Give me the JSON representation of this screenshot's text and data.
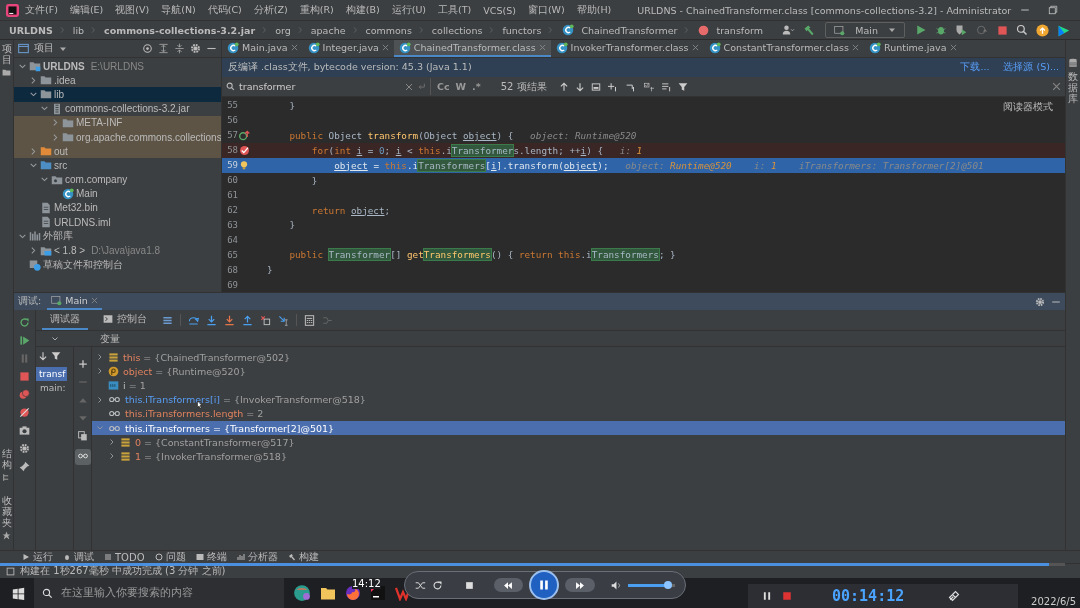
{
  "window": {
    "title": "URLDNS - ChainedTransformer.class [commons-collections-3.2] - Administrator"
  },
  "menu": [
    "文件(F)",
    "编辑(E)",
    "视图(V)",
    "导航(N)",
    "代码(C)",
    "分析(Z)",
    "重构(R)",
    "构建(B)",
    "运行(U)",
    "工具(T)",
    "VCS(S)",
    "窗口(W)",
    "帮助(H)"
  ],
  "breadcrumbs": [
    {
      "label": "URLDNS",
      "bold": true
    },
    {
      "label": "lib",
      "bold": false
    },
    {
      "label": "commons-collections-3.2.jar",
      "bold": true
    },
    {
      "label": "org",
      "bold": false
    },
    {
      "label": "apache",
      "bold": false
    },
    {
      "label": "commons",
      "bold": false
    },
    {
      "label": "collections",
      "bold": false
    },
    {
      "label": "functors",
      "bold": false
    },
    {
      "label": "ChainedTransformer",
      "bold": false
    },
    {
      "label": "transform",
      "bold": false
    }
  ],
  "run_config": "Main",
  "side_labels": {
    "left_top": "项目",
    "left_bottom": [
      "结构",
      "收藏夹"
    ],
    "right": "数据库"
  },
  "project": {
    "title": "项目",
    "tree": [
      {
        "label": "URLDNS",
        "detail": "E:\\URLDNS",
        "kind": "module",
        "expanded": true,
        "selected": false,
        "excluded": false,
        "children": [
          {
            "label": ".idea",
            "kind": "folder",
            "expanded": false,
            "selected": false,
            "excluded": false
          },
          {
            "label": "lib",
            "kind": "folder",
            "expanded": true,
            "selected": true,
            "excluded": false,
            "children": [
              {
                "label": "commons-collections-3.2.jar",
                "kind": "jar",
                "expanded": true,
                "selected": false,
                "excluded": false,
                "children": [
                  {
                    "label": "META-INF",
                    "kind": "folder",
                    "expanded": false,
                    "selected": false,
                    "excluded": true
                  },
                  {
                    "label": "org.apache.commons.collections",
                    "kind": "folder",
                    "expanded": false,
                    "selected": false,
                    "excluded": true
                  }
                ]
              }
            ]
          },
          {
            "label": "out",
            "kind": "output",
            "expanded": false,
            "selected": false,
            "excluded": true
          },
          {
            "label": "src",
            "kind": "source",
            "expanded": true,
            "selected": false,
            "excluded": false,
            "children": [
              {
                "label": "com.company",
                "kind": "package",
                "expanded": true,
                "selected": false,
                "excluded": false,
                "children": [
                  {
                    "label": "Main",
                    "kind": "class",
                    "selected": false,
                    "excluded": false
                  }
                ]
              }
            ]
          },
          {
            "label": "Met32.bin",
            "kind": "file",
            "selected": false,
            "excluded": false
          },
          {
            "label": "URLDNS.iml",
            "kind": "file",
            "selected": false,
            "excluded": false
          }
        ]
      },
      {
        "label": "外部库",
        "kind": "library",
        "expanded": true,
        "selected": false,
        "excluded": false,
        "children": [
          {
            "label": "< 1.8 >",
            "detail": "D:\\Java\\java1.8",
            "kind": "jdk",
            "expanded": false,
            "selected": false,
            "excluded": false
          }
        ]
      },
      {
        "label": "草稿文件和控制台",
        "kind": "scratch",
        "selected": false,
        "excluded": false
      }
    ]
  },
  "editor": {
    "tabs": [
      {
        "label": "Main.java",
        "selected": false
      },
      {
        "label": "Integer.java",
        "selected": false
      },
      {
        "label": "ChainedTransformer.class",
        "selected": true
      },
      {
        "label": "InvokerTransformer.class",
        "selected": false
      },
      {
        "label": "ConstantTransformer.class",
        "selected": false
      },
      {
        "label": "Runtime.java",
        "selected": false
      }
    ],
    "banner": {
      "text": "反编译 .class文件, bytecode version: 45.3 (Java 1.1)",
      "links": [
        "下载...",
        "选择源 (S)..."
      ]
    },
    "search": {
      "value": "transformer",
      "options": [
        "Cc",
        "W",
        ".*"
      ],
      "result": "52 项结果"
    },
    "reader_mode": "阅读器模式",
    "lines": [
      {
        "number": "55",
        "current": false,
        "tokens": [
          {
            "text": "    }",
            "kind": "text"
          }
        ]
      },
      {
        "number": "56",
        "current": false
      },
      {
        "number": "57",
        "kind": "override",
        "current": false,
        "tokens": [
          {
            "text": "    public ",
            "kind": "keyword"
          },
          {
            "text": "Object ",
            "kind": "text"
          },
          {
            "text": "transform",
            "kind": "method"
          },
          {
            "text": "(Object ",
            "kind": "text"
          },
          {
            "text": "object",
            "kind": "variable"
          },
          {
            "text": ") {",
            "kind": "text"
          },
          {
            "text": "   object: Runtime@520",
            "kind": "hint"
          }
        ]
      },
      {
        "number": "58",
        "kind": "breakpoint",
        "current": false,
        "tokens": [
          {
            "text": "        for",
            "kind": "keyword"
          },
          {
            "text": "(",
            "kind": "text"
          },
          {
            "text": "int ",
            "kind": "keyword"
          },
          {
            "text": "i",
            "kind": "variable"
          },
          {
            "text": " = ",
            "kind": "text"
          },
          {
            "text": "0",
            "kind": "number"
          },
          {
            "text": "; ",
            "kind": "text"
          },
          {
            "text": "i",
            "kind": "variable"
          },
          {
            "text": " < ",
            "kind": "text"
          },
          {
            "text": "this",
            "kind": "keyword"
          },
          {
            "text": ".i",
            "kind": "text"
          },
          {
            "text": "Transformer",
            "kind": "match"
          },
          {
            "text": "s.length; ++",
            "kind": "text"
          },
          {
            "text": "i",
            "kind": "variable"
          },
          {
            "text": ") {",
            "kind": "text"
          },
          {
            "text": "   i: ",
            "kind": "hint"
          },
          {
            "text": "1",
            "kind": "hint-value"
          }
        ]
      },
      {
        "number": "59",
        "kind": "bulb",
        "current": true,
        "tokens": [
          {
            "text": "            object",
            "kind": "variable"
          },
          {
            "text": " = ",
            "kind": "text"
          },
          {
            "text": "this",
            "kind": "keyword"
          },
          {
            "text": ".i",
            "kind": "text"
          },
          {
            "text": "Transformers",
            "kind": "match"
          },
          {
            "text": "[",
            "kind": "text"
          },
          {
            "text": "i",
            "kind": "variable"
          },
          {
            "text": "].transform(",
            "kind": "text"
          },
          {
            "text": "object",
            "kind": "variable"
          },
          {
            "text": ");",
            "kind": "text"
          },
          {
            "text": "   object: ",
            "kind": "hint"
          },
          {
            "text": "Runtime@520",
            "kind": "hint-value"
          },
          {
            "text": "    i: ",
            "kind": "hint"
          },
          {
            "text": "1",
            "kind": "hint-value"
          },
          {
            "text": "    iTransformers: Transformer[2]@501",
            "kind": "hint"
          }
        ]
      },
      {
        "number": "60",
        "current": false,
        "tokens": [
          {
            "text": "        }",
            "kind": "text"
          }
        ]
      },
      {
        "number": "61",
        "current": false
      },
      {
        "number": "62",
        "current": false,
        "tokens": [
          {
            "text": "        return ",
            "kind": "keyword"
          },
          {
            "text": "object",
            "kind": "variable"
          },
          {
            "text": ";",
            "kind": "text"
          }
        ]
      },
      {
        "number": "63",
        "current": false,
        "tokens": [
          {
            "text": "    }",
            "kind": "text"
          }
        ]
      },
      {
        "number": "64",
        "current": false
      },
      {
        "number": "65",
        "current": false,
        "tokens": [
          {
            "text": "    public ",
            "kind": "keyword"
          },
          {
            "text": "Transformer",
            "kind": "match"
          },
          {
            "text": "[] ",
            "kind": "text"
          },
          {
            "text": "get",
            "kind": "method"
          },
          {
            "text": "Transformers",
            "kind": "method-match"
          },
          {
            "text": "() { ",
            "kind": "text"
          },
          {
            "text": "return this",
            "kind": "keyword"
          },
          {
            "text": ".i",
            "kind": "text"
          },
          {
            "text": "Transformers",
            "kind": "match"
          },
          {
            "text": "; }",
            "kind": "text"
          }
        ]
      },
      {
        "number": "68",
        "current": false,
        "tokens": [
          {
            "text": "}",
            "kind": "text"
          }
        ]
      },
      {
        "number": "69",
        "current": false
      }
    ]
  },
  "debug": {
    "title": "调试:",
    "tab": "Main",
    "subtabs": [
      {
        "label": "调试器",
        "selected": true
      },
      {
        "label": "控制台",
        "selected": false
      }
    ],
    "variables_header": "变量",
    "frames": [
      {
        "label": "transf",
        "selected": true
      },
      {
        "label": "main:",
        "selected": false
      }
    ],
    "variables": [
      {
        "name": "this",
        "value": " = {ChainedTransformer@502}",
        "kind": "field",
        "expanded": false,
        "selected": false,
        "hovered": false
      },
      {
        "name": "object",
        "value": " = {Runtime@520}",
        "kind": "param",
        "expanded": false,
        "selected": false,
        "hovered": false
      },
      {
        "name": "i",
        "value": " = 1",
        "kind": "primitive",
        "selected": false,
        "hovered": false
      },
      {
        "name": "this.iTransformers[i]",
        "value": " = {InvokerTransformer@518}",
        "kind": "watch",
        "expanded": false,
        "selected": false,
        "hovered": true
      },
      {
        "name": "this.iTransformers.length",
        "value": " = 2",
        "kind": "watch",
        "selected": false,
        "hovered": false
      },
      {
        "name": "this.iTransformers",
        "value": " = {Transformer[2]@501}",
        "kind": "watch",
        "expanded": true,
        "selected": true,
        "hovered": false,
        "children": [
          {
            "name": "0",
            "value": " = {ConstantTransformer@517}",
            "kind": "field",
            "expanded": false,
            "selected": false,
            "hovered": false
          },
          {
            "name": "1",
            "value": " = {InvokerTransformer@518}",
            "kind": "field",
            "expanded": false,
            "selected": false,
            "hovered": false
          }
        ]
      }
    ]
  },
  "tool_tabs": [
    "运行",
    "调试",
    "TODO",
    "问题",
    "终端",
    "分析器",
    "构建"
  ],
  "status": "构建在 1秒267毫秒 中成功完成 (3 分钟 之前)",
  "taskbar": {
    "search_placeholder": "在这里输入你要搜索的内容",
    "tooltip": "14:12",
    "date": "2022/6/5"
  },
  "player": {
    "seek": {
      "level": 0.985
    }
  },
  "recorder": {
    "time": "00:14:12"
  }
}
